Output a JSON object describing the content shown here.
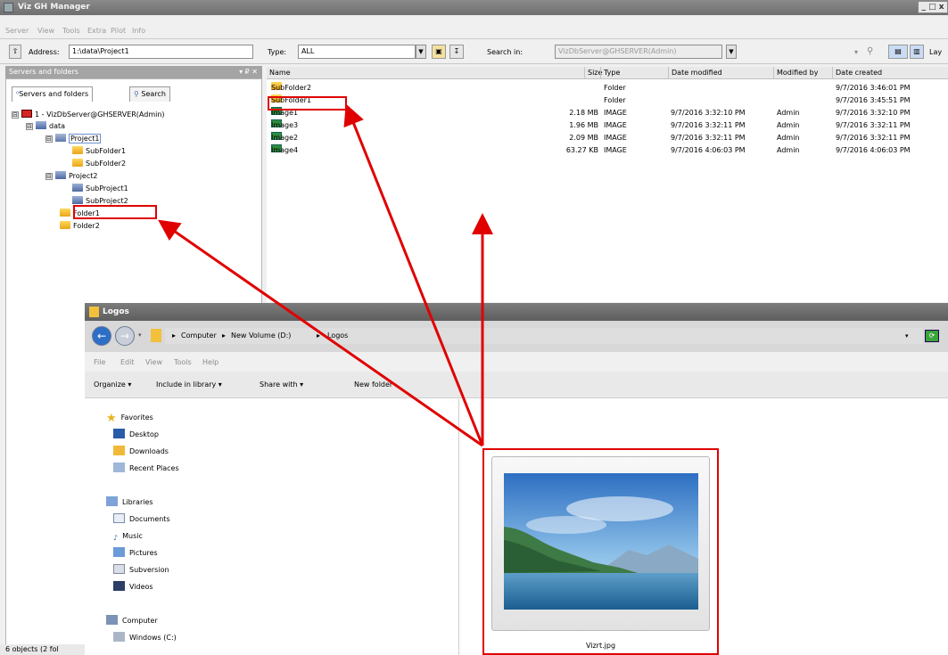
{
  "main_window": {
    "title": "Viz GH Manager",
    "window_controls": "_ □ x",
    "menu": [
      "Server",
      "View",
      "Tools",
      "Extra",
      "Pilot",
      "Info"
    ]
  },
  "toolbar": {
    "address_label": "Address:",
    "address_value": "1:\\data\\Project1",
    "type_label": "Type:",
    "type_value": "ALL",
    "search_label": "Search in:",
    "search_value": "VizDbServer@GHSERVER(Admin)",
    "layout_label": "Lay"
  },
  "left_pane": {
    "header": "Servers and folders",
    "header_controls": "▾ ₽ ✕",
    "tabs": [
      "Servers and folders",
      "Search"
    ],
    "tree": [
      {
        "label": "1 - VizDbServer@GHSERVER(Admin)",
        "icon": "server-icon",
        "expander": "⊟"
      },
      {
        "label": "data",
        "icon": "database-icon",
        "expander": "⊟"
      },
      {
        "label": "Project1",
        "icon": "project-icon",
        "expander": "⊟"
      },
      {
        "label": "SubFolder1",
        "icon": "folder-icon"
      },
      {
        "label": "SubFolder2",
        "icon": "folder-icon"
      },
      {
        "label": "Project2",
        "icon": "project-icon",
        "expander": "⊟"
      },
      {
        "label": "SubProject1",
        "icon": "project-icon"
      },
      {
        "label": "SubProject2",
        "icon": "project-icon"
      },
      {
        "label": "Folder1",
        "icon": "folder-icon"
      },
      {
        "label": "Folder2",
        "icon": "folder-icon"
      }
    ]
  },
  "list": {
    "columns": [
      "Name",
      "Size",
      "Type",
      "Date modified",
      "Modified by",
      "Date created"
    ],
    "rows": [
      {
        "name": "SubFolder2",
        "icon": "folder-icon",
        "size": "",
        "type": "Folder",
        "modified": "",
        "by": "",
        "created": "9/7/2016 3:46:01 PM"
      },
      {
        "name": "SubFolder1",
        "icon": "folder-icon",
        "size": "",
        "type": "Folder",
        "modified": "",
        "by": "",
        "created": "9/7/2016 3:45:51 PM"
      },
      {
        "name": "Image1",
        "icon": "image-icon",
        "size": "2.18 MB",
        "type": "IMAGE",
        "modified": "9/7/2016 3:32:10 PM",
        "by": "Admin",
        "created": "9/7/2016 3:32:10 PM"
      },
      {
        "name": "Image3",
        "icon": "image-icon",
        "size": "1.96 MB",
        "type": "IMAGE",
        "modified": "9/7/2016 3:32:11 PM",
        "by": "Admin",
        "created": "9/7/2016 3:32:11 PM"
      },
      {
        "name": "Image2",
        "icon": "image-icon",
        "size": "2.09 MB",
        "type": "IMAGE",
        "modified": "9/7/2016 3:32:11 PM",
        "by": "Admin",
        "created": "9/7/2016 3:32:11 PM"
      },
      {
        "name": "Image4",
        "icon": "image-icon",
        "size": "63.27 KB",
        "type": "IMAGE",
        "modified": "9/7/2016 4:06:03 PM",
        "by": "Admin",
        "created": "9/7/2016 4:06:03 PM"
      }
    ]
  },
  "explorer": {
    "title": "Logos",
    "breadcrumb": [
      "Computer",
      "New Volume (D:)",
      "Logos"
    ],
    "menu": [
      "File",
      "Edit",
      "View",
      "Tools",
      "Help"
    ],
    "commands": [
      "Organize ▾",
      "Include in library ▾",
      "Share with ▾",
      "New folder"
    ],
    "nav": [
      {
        "label": "Favorites",
        "icon": "star-icon",
        "indent": 0
      },
      {
        "label": "Desktop",
        "icon": "desktop-icon",
        "indent": 1
      },
      {
        "label": "Downloads",
        "icon": "downloads-icon",
        "indent": 1
      },
      {
        "label": "Recent Places",
        "icon": "recent-places-icon",
        "indent": 1
      },
      {
        "label": "Libraries",
        "icon": "libraries-icon",
        "indent": 0
      },
      {
        "label": "Documents",
        "icon": "documents-icon",
        "indent": 1
      },
      {
        "label": "Music",
        "icon": "music-icon",
        "indent": 1
      },
      {
        "label": "Pictures",
        "icon": "pictures-icon",
        "indent": 1
      },
      {
        "label": "Subversion",
        "icon": "subversion-icon",
        "indent": 1
      },
      {
        "label": "Videos",
        "icon": "videos-icon",
        "indent": 1
      },
      {
        "label": "Computer",
        "icon": "computer-icon",
        "indent": 0
      },
      {
        "label": "Windows (C:)",
        "icon": "drive-icon",
        "indent": 1
      }
    ],
    "file_name": "Vizrt.jpg"
  },
  "status": "6 objects (2 fol",
  "colors": {
    "annotation": "#e00000",
    "title_bar": "#6f6f6f"
  }
}
